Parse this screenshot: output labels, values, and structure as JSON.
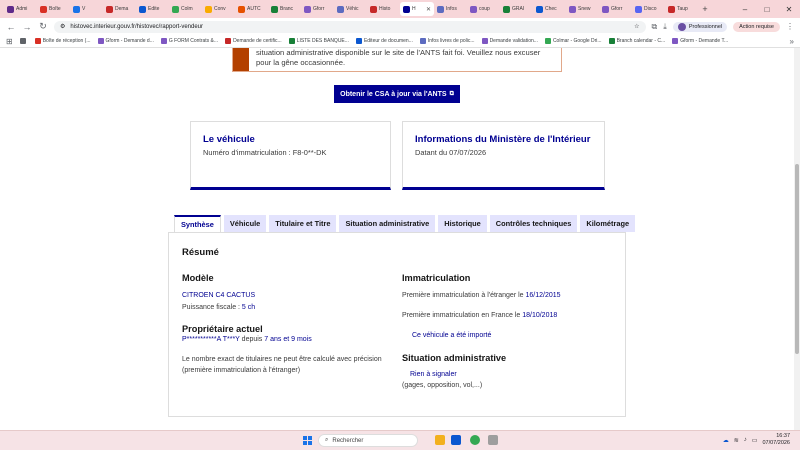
{
  "browser": {
    "tabs": [
      {
        "label": "Admi",
        "color": "#5f2a8a"
      },
      {
        "label": "Boîte",
        "color": "#d93025"
      },
      {
        "label": "V",
        "color": "#1a73e8"
      },
      {
        "label": "Dema",
        "color": "#c62828"
      },
      {
        "label": "Edite",
        "color": "#0b57d0"
      },
      {
        "label": "Colm",
        "color": "#34a853"
      },
      {
        "label": "Conv",
        "color": "#f9ab00"
      },
      {
        "label": "AUTC",
        "color": "#e65100"
      },
      {
        "label": "Branc",
        "color": "#188038"
      },
      {
        "label": "Gforr",
        "color": "#7e57c2"
      },
      {
        "label": "Véhic",
        "color": "#5c6bc0"
      },
      {
        "label": "Histo",
        "color": "#c62828"
      },
      {
        "label": "H",
        "color": "#000091"
      },
      {
        "label": "Infos",
        "color": "#5c6bc0"
      },
      {
        "label": "coup",
        "color": "#7e57c2"
      },
      {
        "label": "GRAI",
        "color": "#188038"
      },
      {
        "label": "Chec",
        "color": "#0b57d0"
      },
      {
        "label": "Snew",
        "color": "#7e57c2"
      },
      {
        "label": "Gforr",
        "color": "#7e57c2"
      },
      {
        "label": "Disco",
        "color": "#5865f2"
      },
      {
        "label": "Taup",
        "color": "#c62828"
      }
    ],
    "url": "histovec.interieur.gouv.fr/histovec/rapport-vendeur",
    "profile_label": "Professionnel",
    "action_label": "Action requise",
    "bookmarks": [
      {
        "label": "",
        "color": "#5f6368"
      },
      {
        "label": "Boîte de réception (...",
        "color": "#d93025"
      },
      {
        "label": "Gform - Demande d...",
        "color": "#7e57c2"
      },
      {
        "label": "G FORM Contrats &...",
        "color": "#7e57c2"
      },
      {
        "label": "Demande de certific...",
        "color": "#c62828"
      },
      {
        "label": "LISTE DES BANQUE...",
        "color": "#188038"
      },
      {
        "label": "Editeur de documen...",
        "color": "#0b57d0"
      },
      {
        "label": "Infos livres de polic...",
        "color": "#5c6bc0"
      },
      {
        "label": "Demande validation...",
        "color": "#7e57c2"
      },
      {
        "label": "Colmar - Google Dri...",
        "color": "#34a853"
      },
      {
        "label": "Branch calendar - C...",
        "color": "#188038"
      },
      {
        "label": "Gform - Demande T...",
        "color": "#7e57c2"
      }
    ]
  },
  "alert": {
    "text": "situation administrative disponible sur le site de l'ANTS fait foi. Veuillez nous excuser pour la gêne occasionnée."
  },
  "csa_button": {
    "label": "Obtenir le CSA à jour via l'ANTS",
    "icon": "external-link-icon"
  },
  "card_vehicle": {
    "title": "Le véhicule",
    "subtitle": "Numéro d'immatriculation : F8-0**-DK"
  },
  "card_info": {
    "title": "Informations du Ministère de l'Intérieur",
    "subtitle": "Datant du 07/07/2026"
  },
  "tabs": [
    "Synthèse",
    "Véhicule",
    "Titulaire et Titre",
    "Situation administrative",
    "Historique",
    "Contrôles techniques",
    "Kilométrage"
  ],
  "summary": {
    "heading": "Résumé",
    "model": {
      "heading": "Modèle",
      "name": "CITROEN C4 CACTUS",
      "power_label": "Puissance fiscale : ",
      "power_value": "5 ch"
    },
    "owner": {
      "heading": "Propriétaire actuel",
      "name": "P***********A T***Y",
      "since_label": " depuis ",
      "duration": "7 ans et 9 mois",
      "note_line1": "Le nombre exact de titulaires ne peut être calculé avec précision",
      "note_line2": "(première immatriculation à l'étranger)"
    },
    "registration": {
      "heading": "Immatriculation",
      "abroad_label": "Première immatriculation à l'étranger le ",
      "abroad_date": "16/12/2015",
      "france_label": "Première immatriculation en France le ",
      "france_date": "18/10/2018",
      "imported_label": "Ce véhicule a été importé"
    },
    "admin": {
      "heading": "Situation administrative",
      "status": "Rien à signaler",
      "details": "(gages, opposition, vol,...)"
    }
  },
  "taskbar": {
    "search_placeholder": "Rechercher",
    "time": "16:37",
    "date": "07/07/2026"
  }
}
